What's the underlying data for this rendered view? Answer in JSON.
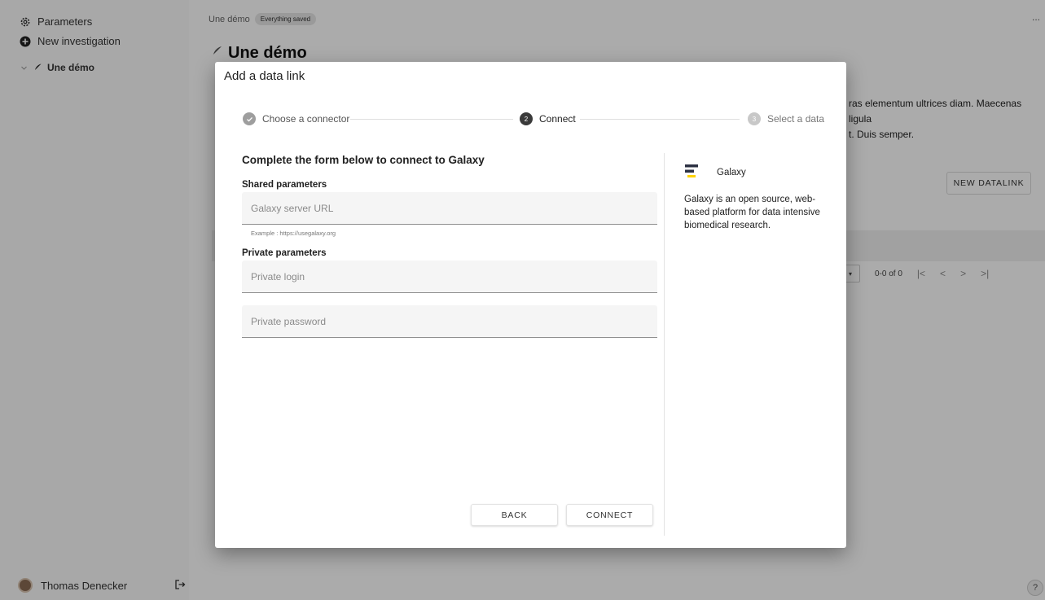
{
  "sidebar": {
    "parameters_label": "Parameters",
    "new_investigation_label": "New investigation",
    "tree_item_label": "Une démo",
    "user_name": "Thomas Denecker"
  },
  "main": {
    "breadcrumb": "Une démo",
    "status_badge": "Everything saved",
    "more_label": "...",
    "title": "Une démo",
    "description_line1": "ras elementum ultrices diam. Maecenas ligula",
    "description_line2": "t. Duis semper.",
    "new_datalink_label": "NEW DATALINK",
    "pager_select": "▾",
    "pager_range": "0-0 of 0",
    "pager_first": "|<",
    "pager_prev": "<",
    "pager_next": ">",
    "pager_last": ">|",
    "help_label": "?"
  },
  "dialog": {
    "title": "Add a data link",
    "steps": [
      {
        "number": "✓",
        "label": "Choose a connector",
        "state": "completed"
      },
      {
        "number": "2",
        "label": "Connect",
        "state": "active"
      },
      {
        "number": "3",
        "label": "Select a data",
        "state": "inactive"
      }
    ],
    "form_heading": "Complete the form below to connect to Galaxy",
    "shared_label": "Shared parameters",
    "url_placeholder": "Galaxy server URL",
    "url_value": "",
    "url_hint": "Example : https://usegalaxy.org",
    "private_label": "Private parameters",
    "login_placeholder": "Private login",
    "login_value": "",
    "password_placeholder": "Private password",
    "password_value": "",
    "connector_name": "Galaxy",
    "connector_description": "Galaxy is an open source, web-based platform for data intensive biomedical research.",
    "back_label": "BACK",
    "connect_label": "CONNECT"
  },
  "colors": {
    "step_completed": "#9e9e9e",
    "step_active": "#3a3a3a",
    "step_inactive": "#c8c8c8",
    "galaxy_logo_dark": "#2c3143",
    "galaxy_logo_accent": "#ffd300",
    "scrim": "rgba(0,0,0,0.33)"
  },
  "icons": {
    "parameters": "gear-icon",
    "new_investigation": "plus-circle-icon",
    "tree_expand": "chevron-down-icon",
    "feather": "feather-icon",
    "logout": "logout-icon",
    "step_done": "check-icon",
    "galaxy": "galaxy-logo-icon"
  }
}
